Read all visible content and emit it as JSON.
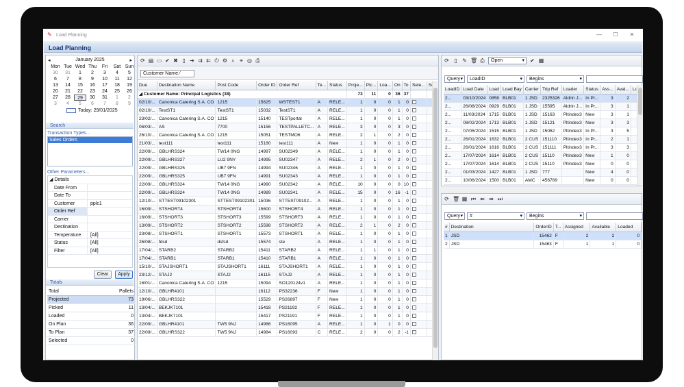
{
  "window": {
    "title": "Load Planning",
    "header": "Load Planning"
  },
  "calendar": {
    "month": "January 2025",
    "daynames": [
      "Mon",
      "Tue",
      "Wed",
      "Thu",
      "Fri",
      "Sat",
      "Sun"
    ],
    "weeks": [
      [
        "30",
        "31",
        "1",
        "2",
        "3",
        "4",
        "5"
      ],
      [
        "6",
        "7",
        "8",
        "9",
        "10",
        "11",
        "12"
      ],
      [
        "13",
        "14",
        "15",
        "16",
        "17",
        "18",
        "19"
      ],
      [
        "20",
        "21",
        "22",
        "23",
        "24",
        "25",
        "26"
      ],
      [
        "27",
        "28",
        "29",
        "30",
        "31",
        "1",
        "2"
      ],
      [
        "3",
        "4",
        "5",
        "6",
        "7",
        "8",
        "9"
      ]
    ],
    "today_label": "Today: 29/01/2025"
  },
  "search": {
    "title": "Search",
    "transaction_types_label": "Transaction Types...",
    "transaction_types": [
      "Sales Orders"
    ],
    "other_params_label": "Other Parameters..."
  },
  "params": {
    "group": "Details",
    "rows": [
      {
        "k": "Date From",
        "v": ""
      },
      {
        "k": "Date To",
        "v": ""
      },
      {
        "k": "Customer",
        "v": "pplc1"
      },
      {
        "k": "Order Ref",
        "v": ""
      },
      {
        "k": "Carrier",
        "v": ""
      },
      {
        "k": "Destination",
        "v": ""
      },
      {
        "k": "Temperature",
        "v": "[All]"
      },
      {
        "k": "Status",
        "v": "[All]"
      },
      {
        "k": "Filter",
        "v": "[All]"
      }
    ]
  },
  "buttons": {
    "clear": "Clear",
    "apply": "Apply"
  },
  "totals": {
    "title": "Totals",
    "header": [
      "Total",
      "Pallets"
    ],
    "rows": [
      {
        "n": "Projected",
        "v": "73"
      },
      {
        "n": "Picked",
        "v": "11"
      },
      {
        "n": "Loaded",
        "v": "0"
      },
      {
        "n": "On Plan",
        "v": "36"
      },
      {
        "n": "To Plan",
        "v": "37"
      },
      {
        "n": "Selected",
        "v": "0"
      }
    ]
  },
  "orders": {
    "group_chip": "Customer Name",
    "columns": [
      "Due",
      "Destination Name",
      "Post Code",
      "Order ID",
      "Order Ref",
      "Te...",
      "Status",
      "Proje...",
      "Pic...",
      "Loa...",
      "On",
      "To",
      "Sele...",
      "Sel..."
    ],
    "group_label": "Customer Name: Principal Logistics (38)",
    "group_totals": [
      "73",
      "11",
      "0",
      "36",
      "37"
    ],
    "rows": [
      [
        "02/10/...",
        "Canonica Catering S.A. CO",
        "1215",
        "15625",
        "WSTEST1",
        "A",
        "RELE...",
        "1",
        "0",
        "0",
        "1",
        "0"
      ],
      [
        "02/10/...",
        "TestST1",
        "TestST1",
        "15032",
        "TestST1",
        "A",
        "RELE...",
        "1",
        "0",
        "0",
        "1",
        "0"
      ],
      [
        "23/02/...",
        "Canonica Catering S.A. CO",
        "1215",
        "15140",
        "TESTportal",
        "A",
        "RELE...",
        "1",
        "0",
        "0",
        "1",
        "0"
      ],
      [
        "06/03/...",
        "AS",
        "7700",
        "15156",
        "TESTPALLETC...",
        "A",
        "RELE...",
        "3",
        "0",
        "0",
        "3",
        "0"
      ],
      [
        "26/10/...",
        "Canonica Catering S.A. CO",
        "1215",
        "15051",
        "TESTMO6",
        "A",
        "RELE...",
        "2",
        "1",
        "0",
        "2",
        "0"
      ],
      [
        "21/03/...",
        "test111",
        "test111",
        "15180",
        "test111",
        "A",
        "New",
        "1",
        "0",
        "0",
        "1",
        "0"
      ],
      [
        "22/09/...",
        "GBLHRS324",
        "TW14 0NG",
        "14997",
        "SU02349",
        "A",
        "RELE...",
        "1",
        "0",
        "0",
        "1",
        "0"
      ],
      [
        "22/09/...",
        "GBLHRS327",
        "LU2 9NY",
        "14995",
        "SU02347",
        "A",
        "RELE...",
        "2",
        "1",
        "0",
        "2",
        "0"
      ],
      [
        "22/09/...",
        "GBLHRS325",
        "UB7 9FN",
        "14994",
        "SU02346",
        "A",
        "RELE...",
        "1",
        "0",
        "0",
        "1",
        "0"
      ],
      [
        "22/09/...",
        "GBLHRS325",
        "UB7 9FN",
        "14991",
        "SU02343",
        "A",
        "RELE...",
        "1",
        "0",
        "0",
        "1",
        "0"
      ],
      [
        "22/09/...",
        "GBLHRS324",
        "TW14 0NG",
        "14990",
        "SU02342",
        "A",
        "RELE...",
        "10",
        "0",
        "0",
        "0",
        "10"
      ],
      [
        "22/09/...",
        "GBLHRS324",
        "TW14 0NG",
        "14989",
        "SU02341",
        "A",
        "RELE...",
        "15",
        "0",
        "0",
        "16",
        "-1"
      ],
      [
        "12/10/...",
        "STTEST09102301",
        "STTEST09102301",
        "15036",
        "STTEST09102...",
        "A",
        "RELE...",
        "1",
        "0",
        "0",
        "1",
        "0"
      ],
      [
        "16/09/...",
        "STSHORT4",
        "STSHORT4",
        "15600",
        "STSHORT4",
        "A",
        "RELE...",
        "1",
        "0",
        "0",
        "1",
        "0"
      ],
      [
        "16/09/...",
        "STSHORT3",
        "STSHORT3",
        "15599",
        "STSHORT3",
        "A",
        "RELE...",
        "1",
        "0",
        "0",
        "1",
        "0"
      ],
      [
        "13/09/...",
        "STSHORT2",
        "STSHORT2",
        "15598",
        "STSHORT2",
        "A",
        "RELE...",
        "2",
        "1",
        "0",
        "2",
        "0"
      ],
      [
        "23/08/...",
        "STSHORT1",
        "STSHORT1",
        "15573",
        "STSHORT1",
        "A",
        "RELE...",
        "1",
        "0",
        "0",
        "1",
        "0"
      ],
      [
        "26/08/...",
        "fdsd",
        "dsfsd",
        "15574",
        "ste",
        "A",
        "RELE...",
        "1",
        "0",
        "0",
        "1",
        "0"
      ],
      [
        "17/04/...",
        "STARB2",
        "STARB2",
        "15411",
        "STARB2",
        "A",
        "RELE...",
        "1",
        "1",
        "0",
        "1",
        "0"
      ],
      [
        "17/04/...",
        "STARB1",
        "STARB1",
        "15410",
        "STARB1",
        "A",
        "RELE...",
        "1",
        "0",
        "0",
        "1",
        "0"
      ],
      [
        "15/10/...",
        "STAJSHORT1",
        "STAJSHORT1",
        "16111",
        "STAJSHORT1",
        "A",
        "RELE...",
        "1",
        "0",
        "0",
        "1",
        "0"
      ],
      [
        "23/12/...",
        "STAJ2",
        "STAJ2",
        "16115",
        "STAJ2",
        "A",
        "RELE...",
        "1",
        "0",
        "0",
        "1",
        "0"
      ],
      [
        "16/01/...",
        "Canonica Catering S.A. CO",
        "1215",
        "15094",
        "SO120124v1",
        "A",
        "RELE...",
        "1",
        "0",
        "0",
        "1",
        "0"
      ],
      [
        "12/10/...",
        "GBLHR4101",
        "",
        "16112",
        "PS32236",
        "F",
        "New",
        "1",
        "0",
        "0",
        "1",
        "0"
      ],
      [
        "19/06/...",
        "GBLHRS322",
        "",
        "15529",
        "PS26897",
        "F",
        "New",
        "1",
        "0",
        "0",
        "1",
        "0"
      ],
      [
        "13/04/...",
        "BEKJK7101",
        "",
        "15418",
        "PS21192",
        "F",
        "RELE...",
        "1",
        "0",
        "0",
        "1",
        "0"
      ],
      [
        "13/04/...",
        "BEKJK7101",
        "",
        "15417",
        "PS21191",
        "F",
        "RELE...",
        "1",
        "0",
        "0",
        "1",
        "0"
      ],
      [
        "22/09/...",
        "GBLHR4101",
        "TW5 9NJ",
        "14986",
        "PS16095",
        "A",
        "RELE...",
        "1",
        "0",
        "1",
        "0",
        "0"
      ],
      [
        "22/09/...",
        "GBLHRS322",
        "TW5 9NJ",
        "14984",
        "PS16093",
        "C",
        "RELE...",
        "2",
        "0",
        "0",
        "2",
        "-1"
      ]
    ]
  },
  "loads": {
    "query_label": "Query",
    "field": "LoadID",
    "op": "Begins",
    "status": "Open",
    "columns": [
      "LoadID",
      "Load Date",
      "Load",
      "Load Bay",
      "Carrier",
      "Trip Ref",
      "Loader",
      "Status",
      "Ass...",
      "Avai...",
      "Loaded"
    ],
    "rows": [
      [
        "2...",
        "03/10/2024",
        "0858",
        "BLB01",
        "1 JSD",
        "2325326",
        "Aldrin J...",
        "In Pr...",
        "3",
        "2",
        "0"
      ],
      [
        "2...",
        "26/08/2024",
        "0929",
        "BLB01",
        "1 JSD",
        "15595",
        "Aldrin J...",
        "In Pr...",
        "3",
        "1",
        "0"
      ],
      [
        "2...",
        "11/03/2024",
        "1715",
        "BLB01",
        "1 JSD",
        "15163",
        "Pltindex3",
        "New",
        "3",
        "1",
        "0"
      ],
      [
        "2...",
        "08/02/2024",
        "1713",
        "BLB01",
        "1 JSD",
        "15121",
        "Pltindex3",
        "New",
        "3",
        "3",
        "0"
      ],
      [
        "2...",
        "07/05/2024",
        "1515",
        "BLB01",
        "1 JSD",
        "15062",
        "Pltindex3",
        "In Pr...",
        "3",
        "5",
        "2"
      ],
      [
        "2...",
        "26/01/2024",
        "1632",
        "BLB01",
        "2 CUS",
        "151110",
        "Pltindex3",
        "In Pr...",
        "2",
        "1",
        "0"
      ],
      [
        "2...",
        "26/01/2024",
        "1616",
        "BLB01",
        "2 CUS",
        "151111",
        "Pltindex3",
        "In Pr...",
        "3",
        "3",
        "0"
      ],
      [
        "2...",
        "17/07/2024",
        "1614",
        "BLB01",
        "2 CUS",
        "15110",
        "Pltindex3",
        "New",
        "1",
        "0",
        "0"
      ],
      [
        "2...",
        "17/07/2024",
        "1614",
        "BLB01",
        "2 CUS",
        "15110",
        "Pltindex3",
        "New",
        "0",
        "0",
        "0"
      ],
      [
        "2...",
        "01/03/2024",
        "1427",
        "BLB01",
        "1 JSD",
        "777",
        "",
        "New",
        "4",
        "0",
        "0"
      ],
      [
        "2...",
        "10/06/2024",
        "1500",
        "BLB01",
        "AMC",
        "456789",
        "",
        "New",
        "0",
        "0",
        "0"
      ]
    ]
  },
  "drops": {
    "query_label": "Query",
    "field": "#",
    "op": "Begins",
    "columns": [
      "#",
      "Destination",
      "OrderID",
      "T...",
      "Assigned",
      "Available",
      "Loaded"
    ],
    "rows": [
      [
        "1",
        "JSD",
        "15462",
        "F",
        "2",
        "2",
        "0"
      ],
      [
        "2",
        "JSD",
        "15463",
        "F",
        "1",
        "1",
        "0"
      ]
    ]
  }
}
